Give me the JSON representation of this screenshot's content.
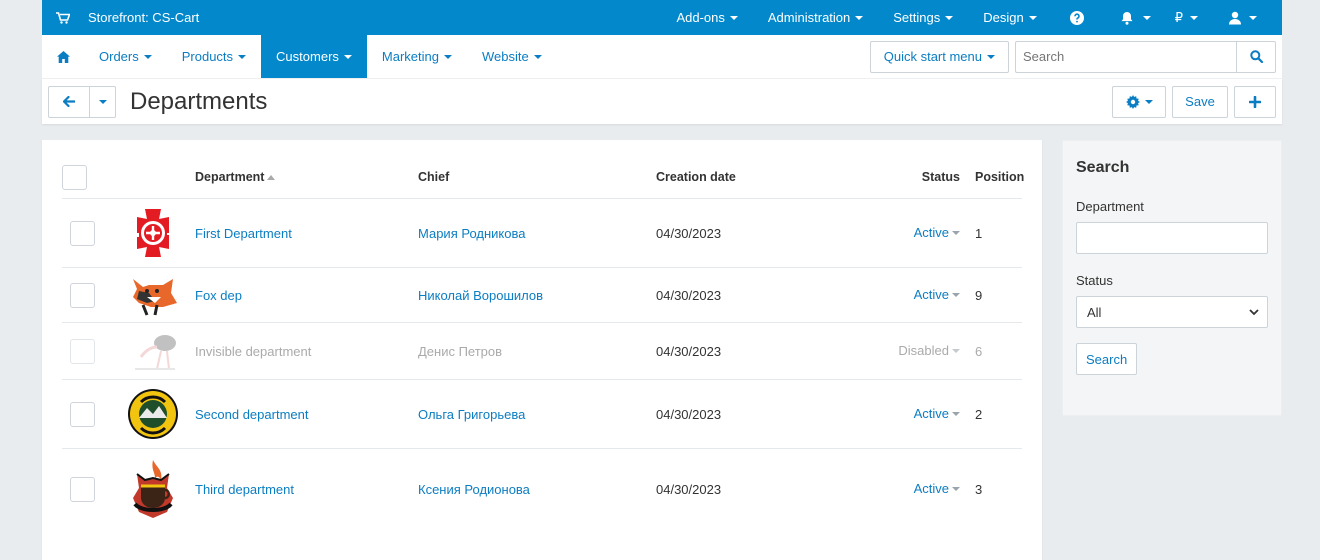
{
  "topbar": {
    "storefront": "Storefront: CS-Cart",
    "menus": [
      "Add-ons",
      "Administration",
      "Settings",
      "Design"
    ],
    "currency": "₽",
    "color": "#0388cc"
  },
  "nav": {
    "items": [
      {
        "label": "Orders",
        "active": false
      },
      {
        "label": "Products",
        "active": false
      },
      {
        "label": "Customers",
        "active": true
      },
      {
        "label": "Marketing",
        "active": false
      },
      {
        "label": "Website",
        "active": false
      }
    ],
    "quick_start": "Quick start menu",
    "search_placeholder": "Search"
  },
  "page": {
    "title": "Departments",
    "save_label": "Save"
  },
  "table": {
    "headers": {
      "department": "Department",
      "chief": "Chief",
      "date": "Creation date",
      "status": "Status",
      "position": "Position"
    },
    "rows": [
      {
        "department": "First Department",
        "chief": "Мария Родникова",
        "date": "04/30/2023",
        "status": "Active",
        "position": "1",
        "disabled": false,
        "logo": "fire-dept-cross-logo"
      },
      {
        "department": "Fox dep",
        "chief": "Николай Ворошилов",
        "date": "04/30/2023",
        "status": "Active",
        "position": "9",
        "disabled": false,
        "logo": "fox-mascot-logo"
      },
      {
        "department": "Invisible department",
        "chief": "Денис Петров",
        "date": "04/30/2023",
        "status": "Disabled",
        "position": "6",
        "disabled": true,
        "logo": "ostrich-logo"
      },
      {
        "department": "Second department",
        "chief": "Ольга Григорьева",
        "date": "04/30/2023",
        "status": "Active",
        "position": "2",
        "disabled": false,
        "logo": "marin-county-fire-logo"
      },
      {
        "department": "Third department",
        "chief": "Ксения Родионова",
        "date": "04/30/2023",
        "status": "Active",
        "position": "3",
        "disabled": false,
        "logo": "coffee-fire-logo"
      }
    ]
  },
  "sidebar": {
    "title": "Search",
    "department_label": "Department",
    "status_label": "Status",
    "status_value": "All",
    "search_button": "Search"
  }
}
